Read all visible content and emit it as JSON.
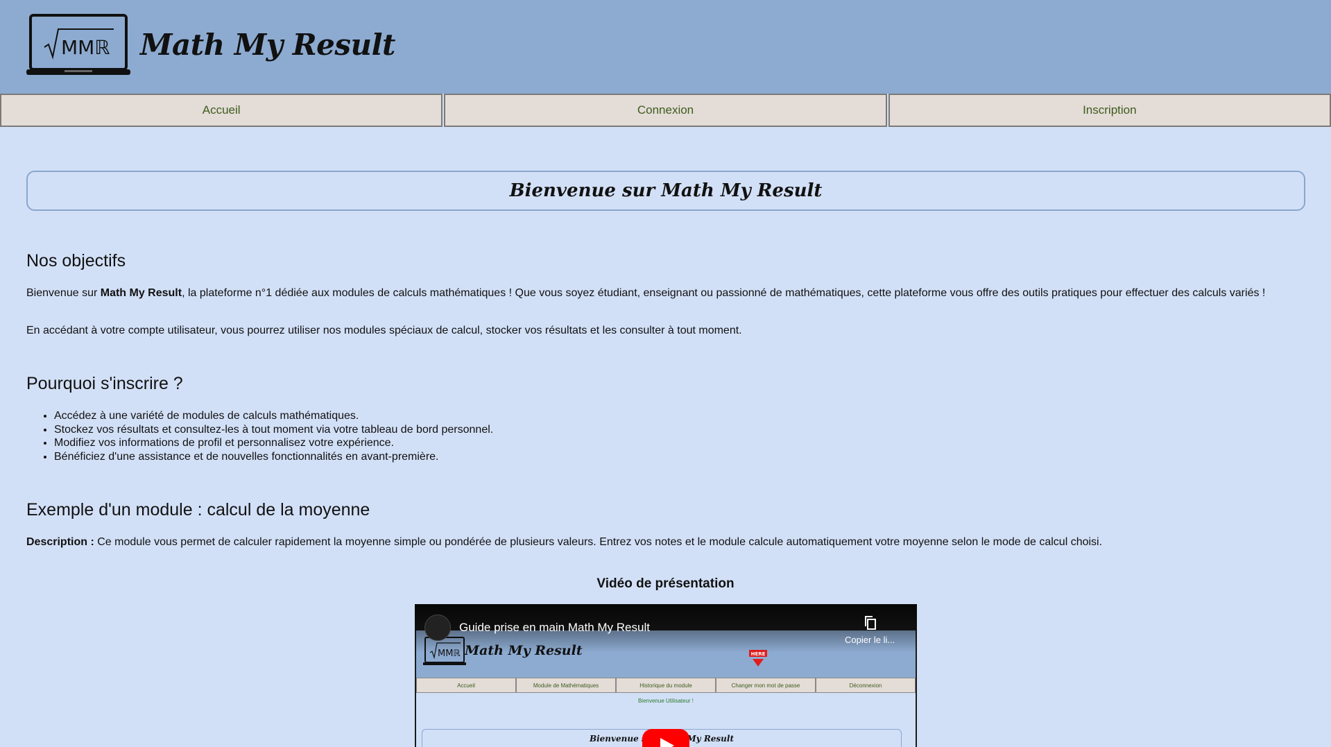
{
  "header": {
    "site_title": "Math My Result",
    "logo_text": "MMℝ"
  },
  "nav": {
    "items": [
      {
        "label": "Accueil"
      },
      {
        "label": "Connexion"
      },
      {
        "label": "Inscription"
      }
    ]
  },
  "welcome": {
    "title": "Bienvenue sur Math My Result"
  },
  "objectives": {
    "title": "Nos objectifs",
    "p1_prefix": "Bienvenue sur ",
    "p1_bold": "Math My Result",
    "p1_suffix": ", la plateforme n°1 dédiée aux modules de calculs mathématiques ! Que vous soyez étudiant, enseignant ou passionné de mathématiques, cette plateforme vous offre des outils pratiques pour effectuer des calculs variés !",
    "p2": "En accédant à votre compte utilisateur, vous pourrez utiliser nos modules spéciaux de calcul, stocker vos résultats et les consulter à tout moment."
  },
  "why": {
    "title": "Pourquoi s'inscrire ?",
    "items": [
      "Accédez à une variété de modules de calculs mathématiques.",
      "Stockez vos résultats et consultez-les à tout moment via votre tableau de bord personnel.",
      "Modifiez vos informations de profil et personnalisez votre expérience.",
      "Bénéficiez d'une assistance et de nouvelles fonctionnalités en avant-première."
    ]
  },
  "example": {
    "title": "Exemple d'un module : calcul de la moyenne",
    "desc_label": "Description :",
    "desc_text": " Ce module vous permet de calculer rapidement la moyenne simple ou pondérée de plusieurs valeurs. Entrez vos notes et le module calcule automatiquement votre moyenne selon le mode de calcul choisi."
  },
  "video": {
    "heading": "Vidéo de présentation",
    "yt_title": "Guide prise en main Math My Result",
    "copy_label": "Copier le li...",
    "inner_title": "Math My Result",
    "inner_here": "HERE",
    "inner_nav": [
      "Accueil",
      "Module de Mathématiques",
      "Historique du module",
      "Changer mon mot de passe",
      "Déconnexion"
    ],
    "inner_hello": "Bienvenue Utilisateur !",
    "inner_box": "Bienvenue sur Math My Result"
  }
}
